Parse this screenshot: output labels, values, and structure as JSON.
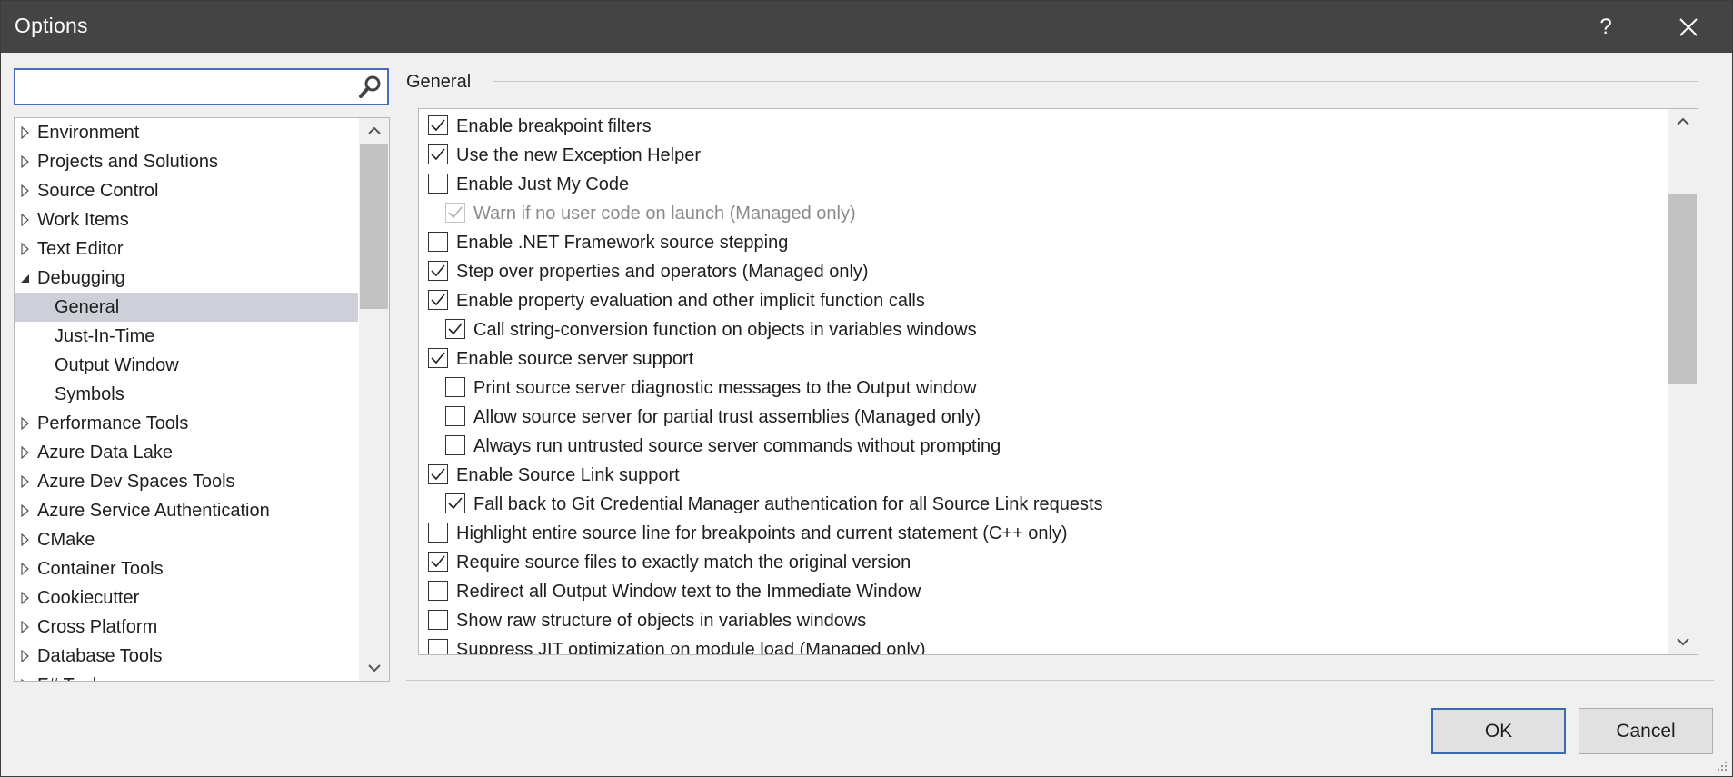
{
  "window": {
    "title": "Options",
    "help_glyph": "?",
    "close_glyph": "✕"
  },
  "search": {
    "value": "",
    "icon": "search-icon"
  },
  "tree": {
    "items": [
      {
        "label": "Environment",
        "level": 0,
        "state": "collapsed"
      },
      {
        "label": "Projects and Solutions",
        "level": 0,
        "state": "collapsed"
      },
      {
        "label": "Source Control",
        "level": 0,
        "state": "collapsed"
      },
      {
        "label": "Work Items",
        "level": 0,
        "state": "collapsed"
      },
      {
        "label": "Text Editor",
        "level": 0,
        "state": "collapsed"
      },
      {
        "label": "Debugging",
        "level": 0,
        "state": "expanded"
      },
      {
        "label": "General",
        "level": 1,
        "state": "selected"
      },
      {
        "label": "Just-In-Time",
        "level": 1,
        "state": "leaf"
      },
      {
        "label": "Output Window",
        "level": 1,
        "state": "leaf"
      },
      {
        "label": "Symbols",
        "level": 1,
        "state": "leaf"
      },
      {
        "label": "Performance Tools",
        "level": 0,
        "state": "collapsed"
      },
      {
        "label": "Azure Data Lake",
        "level": 0,
        "state": "collapsed"
      },
      {
        "label": "Azure Dev Spaces Tools",
        "level": 0,
        "state": "collapsed"
      },
      {
        "label": "Azure Service Authentication",
        "level": 0,
        "state": "collapsed"
      },
      {
        "label": "CMake",
        "level": 0,
        "state": "collapsed"
      },
      {
        "label": "Container Tools",
        "level": 0,
        "state": "collapsed"
      },
      {
        "label": "Cookiecutter",
        "level": 0,
        "state": "collapsed"
      },
      {
        "label": "Cross Platform",
        "level": 0,
        "state": "collapsed"
      },
      {
        "label": "Database Tools",
        "level": 0,
        "state": "collapsed"
      },
      {
        "label": "F# Tools",
        "level": 0,
        "state": "collapsed"
      }
    ],
    "scroll_position": 0.0
  },
  "section": {
    "title": "General"
  },
  "options": {
    "items": [
      {
        "label": "Enable breakpoint filters",
        "checked": true,
        "level": 0,
        "enabled": true
      },
      {
        "label": "Use the new Exception Helper",
        "checked": true,
        "level": 0,
        "enabled": true
      },
      {
        "label": "Enable Just My Code",
        "checked": false,
        "level": 0,
        "enabled": true
      },
      {
        "label": "Warn if no user code on launch (Managed only)",
        "checked": true,
        "level": 1,
        "enabled": false
      },
      {
        "label": "Enable .NET Framework source stepping",
        "checked": false,
        "level": 0,
        "enabled": true
      },
      {
        "label": "Step over properties and operators (Managed only)",
        "checked": true,
        "level": 0,
        "enabled": true
      },
      {
        "label": "Enable property evaluation and other implicit function calls",
        "checked": true,
        "level": 0,
        "enabled": true
      },
      {
        "label": "Call string-conversion function on objects in variables windows",
        "checked": true,
        "level": 1,
        "enabled": true
      },
      {
        "label": "Enable source server support",
        "checked": true,
        "level": 0,
        "enabled": true
      },
      {
        "label": "Print source server diagnostic messages to the Output window",
        "checked": false,
        "level": 1,
        "enabled": true
      },
      {
        "label": "Allow source server for partial trust assemblies (Managed only)",
        "checked": false,
        "level": 1,
        "enabled": true
      },
      {
        "label": "Always run untrusted source server commands without prompting",
        "checked": false,
        "level": 1,
        "enabled": true
      },
      {
        "label": "Enable Source Link support",
        "checked": true,
        "level": 0,
        "enabled": true
      },
      {
        "label": "Fall back to Git Credential Manager authentication for all Source Link requests",
        "checked": true,
        "level": 1,
        "enabled": true
      },
      {
        "label": "Highlight entire source line for breakpoints and current statement (C++ only)",
        "checked": false,
        "level": 0,
        "enabled": true
      },
      {
        "label": "Require source files to exactly match the original version",
        "checked": true,
        "level": 0,
        "enabled": true
      },
      {
        "label": "Redirect all Output Window text to the Immediate Window",
        "checked": false,
        "level": 0,
        "enabled": true
      },
      {
        "label": "Show raw structure of objects in variables windows",
        "checked": false,
        "level": 0,
        "enabled": true
      },
      {
        "label": "Suppress JIT optimization on module load (Managed only)",
        "checked": false,
        "level": 0,
        "enabled": true
      }
    ],
    "scroll_position": 0.2
  },
  "buttons": {
    "ok_label": "OK",
    "cancel_label": "Cancel"
  },
  "colors": {
    "titlebar": "#444444",
    "selection": "#cdd0d8",
    "focus_border": "#3c6ab0"
  }
}
